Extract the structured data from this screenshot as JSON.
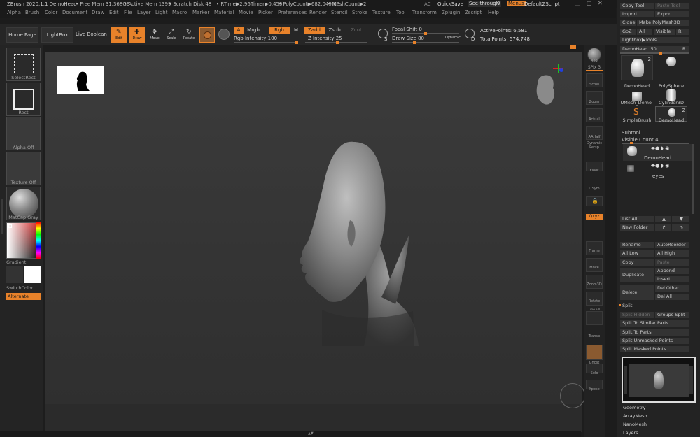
{
  "title": {
    "app": "ZBrush 2020.1.1 DemoHead",
    "free_mem": "• Free Mem 31.368GB",
    "active_mem": "• Active Mem 1399",
    "scratch": "• Scratch Disk 48",
    "rtime": "• RTime▶2.96",
    "timer": "Timer▶0.455",
    "polycount": "• PolyCount▶682.049 KP",
    "meshcount": "• MeshCount▶2",
    "ac": "AC",
    "quicksave": "QuickSave",
    "see_through": "See-through",
    "see_through_val": "0",
    "menus": "Menus",
    "script": "DefaultZScript"
  },
  "menu": [
    "Alpha",
    "Brush",
    "Color",
    "Document",
    "Draw",
    "Edit",
    "File",
    "Layer",
    "Light",
    "Macro",
    "Marker",
    "Material",
    "Movie",
    "Picker",
    "Preferences",
    "Render",
    "Stencil",
    "Stroke",
    "Texture",
    "Tool",
    "Transform",
    "Zplugin",
    "Zscript",
    "Help"
  ],
  "toolbar": {
    "home": "Home Page",
    "lightbox": "LightBox",
    "liveboolean": "Live Boolean",
    "edit": "Edit",
    "draw": "Draw",
    "move": "Move",
    "scale": "Scale",
    "rotate": "Rotate",
    "a": "A",
    "mrgb": "Mrgb",
    "rgb": "Rgb",
    "m": "M",
    "zadd": "Zadd",
    "zsub": "Zsub",
    "zcut": "Zcut",
    "rgb_intensity": "Rgb Intensity 100",
    "z_intensity": "Z Intensity 25",
    "focal_shift": "Focal Shift 0",
    "draw_size": "Draw Size 80",
    "dynamic": "Dynamic",
    "active_points": "ActivePoints: 6,581",
    "total_points": "TotalPoints: 574,748",
    "s": "S",
    "d": "D"
  },
  "left": {
    "selectrect": "SelectRect",
    "rect": "Rect",
    "alpha_off": "Alpha Off",
    "texture_off": "Texture Off",
    "matcap": "MatCap Gray",
    "gradient": "Gradient",
    "switchcolor": "SwitchColor",
    "alternate": "Alternate",
    "colors": {
      "main": "#000000",
      "secondary": "#ffffff",
      "accent": "#e8822a"
    }
  },
  "shelf": [
    "BPR",
    "SPix 3",
    "Scroll",
    "Zoom",
    "Actual",
    "AAHalf",
    "Dynamic Persp",
    "Floor",
    "L.Sym",
    "Qxyz",
    "Frame",
    "Move",
    "Zoom3D",
    "Rotate",
    "Line Fill PolyF",
    "Transp",
    "Ghost",
    "Solo",
    "Xpose"
  ],
  "tool": {
    "copy_tool": "Copy Tool",
    "paste_tool": "Paste Tool",
    "import": "Import",
    "export": "Export",
    "clone": "Clone",
    "make_polymesh": "Make PolyMesh3D",
    "goz": "GoZ",
    "all": "All",
    "visible": "Visible",
    "r": "R",
    "lightbox_tools": "Lightbox▶Tools",
    "demohead_slider": "DemoHead. 50",
    "thumbs": [
      "DemoHead",
      "PolySphere",
      "UMesh_Demo-",
      "Cylinder3D",
      "SimpleBrush",
      "DemoHead"
    ],
    "thumb_counts": [
      "2",
      "2"
    ],
    "subtool": "Subtool",
    "visible_count": "Visible Count 4",
    "subtools": [
      "DemoHead",
      "eyes"
    ],
    "list_all": "List All",
    "new_folder": "New Folder",
    "rename": "Rename",
    "autoreorder": "AutoReorder",
    "all_low": "All Low",
    "all_high": "All High",
    "copy": "Copy",
    "paste": "Paste",
    "append": "Append",
    "duplicate": "Duplicate",
    "insert": "Insert",
    "delete": "Delete",
    "del_other": "Del Other",
    "del_all": "Del All",
    "split": "Split",
    "split_hidden": "Split Hidden",
    "groups_split": "Groups Split",
    "split_similar": "Split To Similar Parts",
    "split_parts": "Split To Parts",
    "split_unmasked": "Split Unmasked Points",
    "split_masked": "Split Masked Points",
    "menu_items": [
      "Geometry",
      "ArrayMesh",
      "NanoMesh",
      "Layers"
    ]
  }
}
